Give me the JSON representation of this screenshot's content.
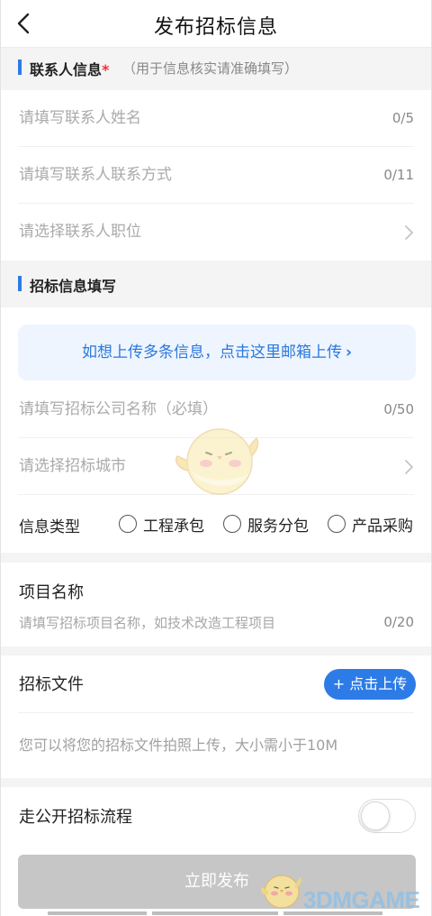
{
  "nav": {
    "title": "发布招标信息",
    "back_icon": "chevron-left-icon"
  },
  "contact_section": {
    "title": "联系人信息",
    "required_mark": "*",
    "hint": "（用于信息核实请准确填写）",
    "name": {
      "placeholder": "请填写联系人姓名",
      "value": "",
      "counter": "0/5"
    },
    "phone": {
      "placeholder": "请填写联系人联系方式",
      "value": "",
      "counter": "0/11"
    },
    "position": {
      "placeholder": "请选择联系人职位",
      "value": ""
    }
  },
  "bid_section": {
    "title": "招标信息填写",
    "banner": {
      "text": "如想上传多条信息，点击这里邮箱上传",
      "arrow": "›"
    },
    "company": {
      "placeholder": "请填写招标公司名称（必填）",
      "value": "",
      "counter": "0/50"
    },
    "city": {
      "placeholder": "请选择招标城市",
      "value": ""
    },
    "info_type": {
      "label": "信息类型",
      "options": [
        "工程承包",
        "服务分包",
        "产品采购"
      ],
      "selected": ""
    }
  },
  "project": {
    "title": "项目名称",
    "placeholder": "请填写招标项目名称，如技术改造工程项目",
    "value": "",
    "counter": "0/20"
  },
  "bid_file": {
    "title": "招标文件",
    "upload_label": "+ 点击上传",
    "hint": "您可以将您的招标文件拍照上传，大小需小于10M"
  },
  "public_process": {
    "label": "走公开招标流程",
    "enabled": false
  },
  "submit": {
    "label": "立即发布"
  },
  "watermark": {
    "text": "3DMGAME"
  },
  "colors": {
    "accent": "#2d7be6",
    "banner_bg": "#eef5fe",
    "section_bg": "#f4f4f4",
    "disabled_button": "#c6c6c6",
    "required": "#e33333"
  }
}
